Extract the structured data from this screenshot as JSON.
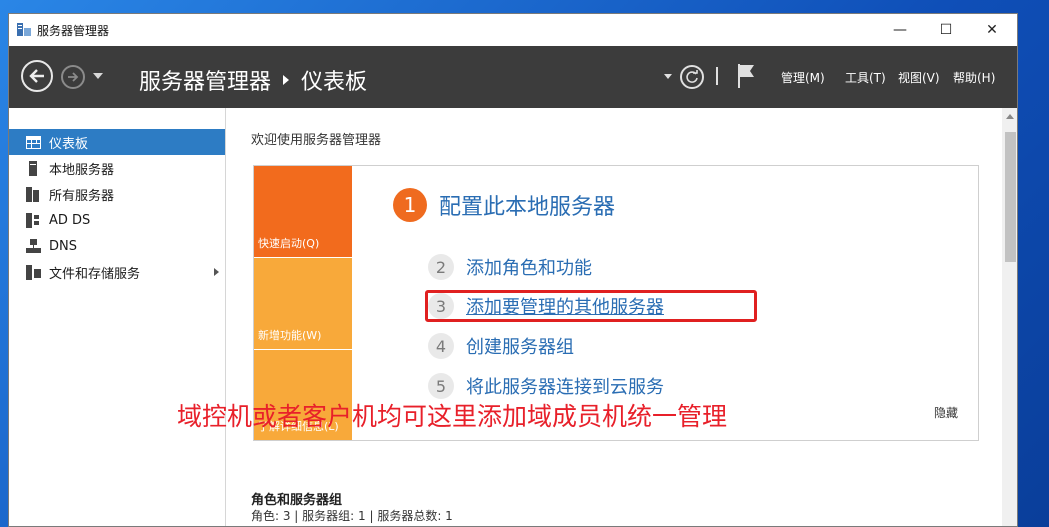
{
  "window": {
    "title": "服务器管理器",
    "controls": {
      "minimize": "—",
      "maximize": "☐",
      "close": "✕"
    }
  },
  "navbar": {
    "breadcrumb_app": "服务器管理器",
    "breadcrumb_page": "仪表板",
    "menus": [
      {
        "label": "管理(M)"
      },
      {
        "label": "工具(T)"
      },
      {
        "label": "视图(V)"
      },
      {
        "label": "帮助(H)"
      }
    ]
  },
  "sidebar": {
    "items": [
      {
        "label": "仪表板",
        "icon": "dashboard-icon",
        "active": true
      },
      {
        "label": "本地服务器",
        "icon": "server-icon"
      },
      {
        "label": "所有服务器",
        "icon": "servers-icon"
      },
      {
        "label": "AD DS",
        "icon": "ad-ds-icon"
      },
      {
        "label": "DNS",
        "icon": "dns-icon"
      },
      {
        "label": "文件和存储服务",
        "icon": "storage-icon",
        "has_arrow": true
      }
    ]
  },
  "main": {
    "welcome": "欢迎使用服务器管理器",
    "tiles": [
      {
        "label": "快速启动(Q)",
        "color": "#f26b1d"
      },
      {
        "label": "新增功能(W)",
        "color": "#f8a93a"
      },
      {
        "label": "了解详细信息(L)",
        "color": "#f8a93a"
      }
    ],
    "step1": {
      "num": "1",
      "label": "配置此本地服务器"
    },
    "steps": [
      {
        "num": "2",
        "label": "添加角色和功能"
      },
      {
        "num": "3",
        "label": "添加要管理的其他服务器"
      },
      {
        "num": "4",
        "label": "创建服务器组"
      },
      {
        "num": "5",
        "label": "将此服务器连接到云服务"
      }
    ],
    "hide": "隐藏",
    "annotation": "域控机或者客户机均可这里添加域成员机统一管理",
    "roles_title": "角色和服务器组",
    "roles_summary": "角色: 3 | 服务器组: 1 | 服务器总数: 1"
  },
  "colors": {
    "accent": "#2d7cc4",
    "orange": "#f26b1d",
    "light_orange": "#f8a93a",
    "link": "#2a6db3",
    "annotation": "#e8202a",
    "navbar": "#3c3c3c"
  }
}
